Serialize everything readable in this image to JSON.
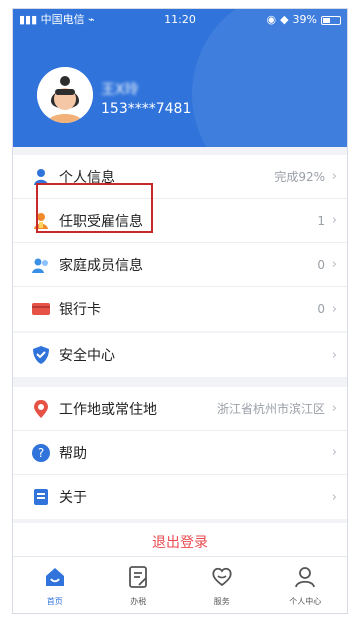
{
  "status_bar": {
    "carrier": "中国电信",
    "time": "11:20",
    "battery_text": "39%"
  },
  "profile": {
    "name": "王X玲",
    "phone": "153****7481"
  },
  "sections": [
    {
      "rows": [
        {
          "label": "个人信息",
          "value": "完成92%",
          "icon": "person-icon",
          "color": "#2f73db"
        },
        {
          "label": "任职受雇信息",
          "value": "1",
          "icon": "employment-icon",
          "color": "#f08a2a"
        },
        {
          "label": "家庭成员信息",
          "value": "0",
          "icon": "family-icon",
          "color": "#3a8fe6"
        },
        {
          "label": "银行卡",
          "value": "0",
          "icon": "bank-card-icon",
          "color": "#e65246"
        }
      ]
    },
    {
      "rows": [
        {
          "label": "安全中心",
          "value": "",
          "icon": "shield-icon",
          "color": "#2f73db"
        }
      ]
    },
    {
      "rows": [
        {
          "label": "工作地或常住地",
          "value": "浙江省杭州市滨江区",
          "icon": "location-icon",
          "color": "#e65246"
        },
        {
          "label": "帮助",
          "value": "",
          "icon": "help-icon",
          "color": "#2f73db"
        },
        {
          "label": "关于",
          "value": "",
          "icon": "about-icon",
          "color": "#2f73db"
        }
      ]
    }
  ],
  "logout_label": "退出登录",
  "tabs": [
    {
      "label": "首页",
      "icon": "home-icon",
      "active": true
    },
    {
      "label": "办税",
      "icon": "tax-icon",
      "active": false
    },
    {
      "label": "服务",
      "icon": "service-icon",
      "active": false
    },
    {
      "label": "个人中心",
      "icon": "profile-icon",
      "active": false
    }
  ],
  "colors": {
    "brand_blue": "#2f73db",
    "logout_red": "#ea4b52",
    "highlight_red": "#c7282a"
  }
}
